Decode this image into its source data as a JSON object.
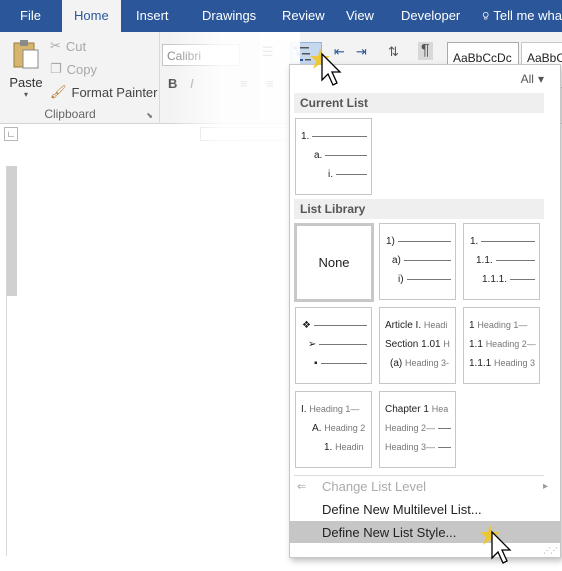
{
  "tabs": [
    {
      "label": "File"
    },
    {
      "label": "Home"
    },
    {
      "label": "Insert"
    },
    {
      "label": "Drawings"
    },
    {
      "label": "Review"
    },
    {
      "label": "View"
    },
    {
      "label": "Developer"
    }
  ],
  "tell_me": "Tell me wha",
  "clipboard": {
    "paste": "Paste",
    "cut": "Cut",
    "copy": "Copy",
    "format_painter": "Format Painter",
    "group_label": "Clipboard"
  },
  "font": {
    "name": "Calibri",
    "bold": "B",
    "italic": "I"
  },
  "styles": [
    "AaBbCcDc",
    "AaBbCc"
  ],
  "menu": {
    "filter": "All",
    "current_list_heading": "Current List",
    "list_library_heading": "List Library",
    "current_list": [
      {
        "num": "1.",
        "text": ""
      },
      {
        "num": "a.",
        "text": ""
      },
      {
        "num": "i.",
        "text": ""
      }
    ],
    "library": [
      {
        "kind": "none",
        "label": "None"
      },
      {
        "kind": "list",
        "rows": [
          {
            "num": "1)",
            "text": ""
          },
          {
            "num": "a)",
            "text": ""
          },
          {
            "num": "i)",
            "text": ""
          }
        ]
      },
      {
        "kind": "list",
        "rows": [
          {
            "num": "1.",
            "text": ""
          },
          {
            "num": "1.1.",
            "text": ""
          },
          {
            "num": "1.1.1.",
            "text": ""
          }
        ]
      },
      {
        "kind": "list",
        "rows": [
          {
            "num": "❖",
            "text": ""
          },
          {
            "num": "➢",
            "text": ""
          },
          {
            "num": "▪",
            "text": ""
          }
        ]
      },
      {
        "kind": "list",
        "rows": [
          {
            "num": "Article I.",
            "text": "Headi"
          },
          {
            "num": "Section 1.01",
            "text": "H"
          },
          {
            "num": "(a)",
            "text": "Heading 3-"
          }
        ]
      },
      {
        "kind": "list",
        "rows": [
          {
            "num": "1",
            "text": "Heading 1—"
          },
          {
            "num": "1.1",
            "text": "Heading 2—"
          },
          {
            "num": "1.1.1",
            "text": "Heading 3"
          }
        ]
      },
      {
        "kind": "list",
        "rows": [
          {
            "num": "I.",
            "text": "Heading 1—"
          },
          {
            "num": "A.",
            "text": "Heading 2"
          },
          {
            "num": "1.",
            "text": "Headin"
          }
        ]
      },
      {
        "kind": "list",
        "rows": [
          {
            "num": "Chapter 1",
            "text": "Hea"
          },
          {
            "num": "",
            "text": "Heading 2—"
          },
          {
            "num": "",
            "text": "Heading 3—"
          }
        ]
      }
    ],
    "change_list_level": "Change List Level",
    "define_multilevel": "Define New Multilevel List...",
    "define_list_style": "Define New List Style..."
  },
  "colors": {
    "ribbon_blue": "#2b579a",
    "highlight": "#c6c6c6",
    "cursor_burst": "#f5c518"
  },
  "icons": [
    "paste-icon",
    "cut-icon",
    "copy-icon",
    "format-painter-icon",
    "lightbulb-icon",
    "multilevel-list-icon",
    "mouse-cursor-icon"
  ]
}
